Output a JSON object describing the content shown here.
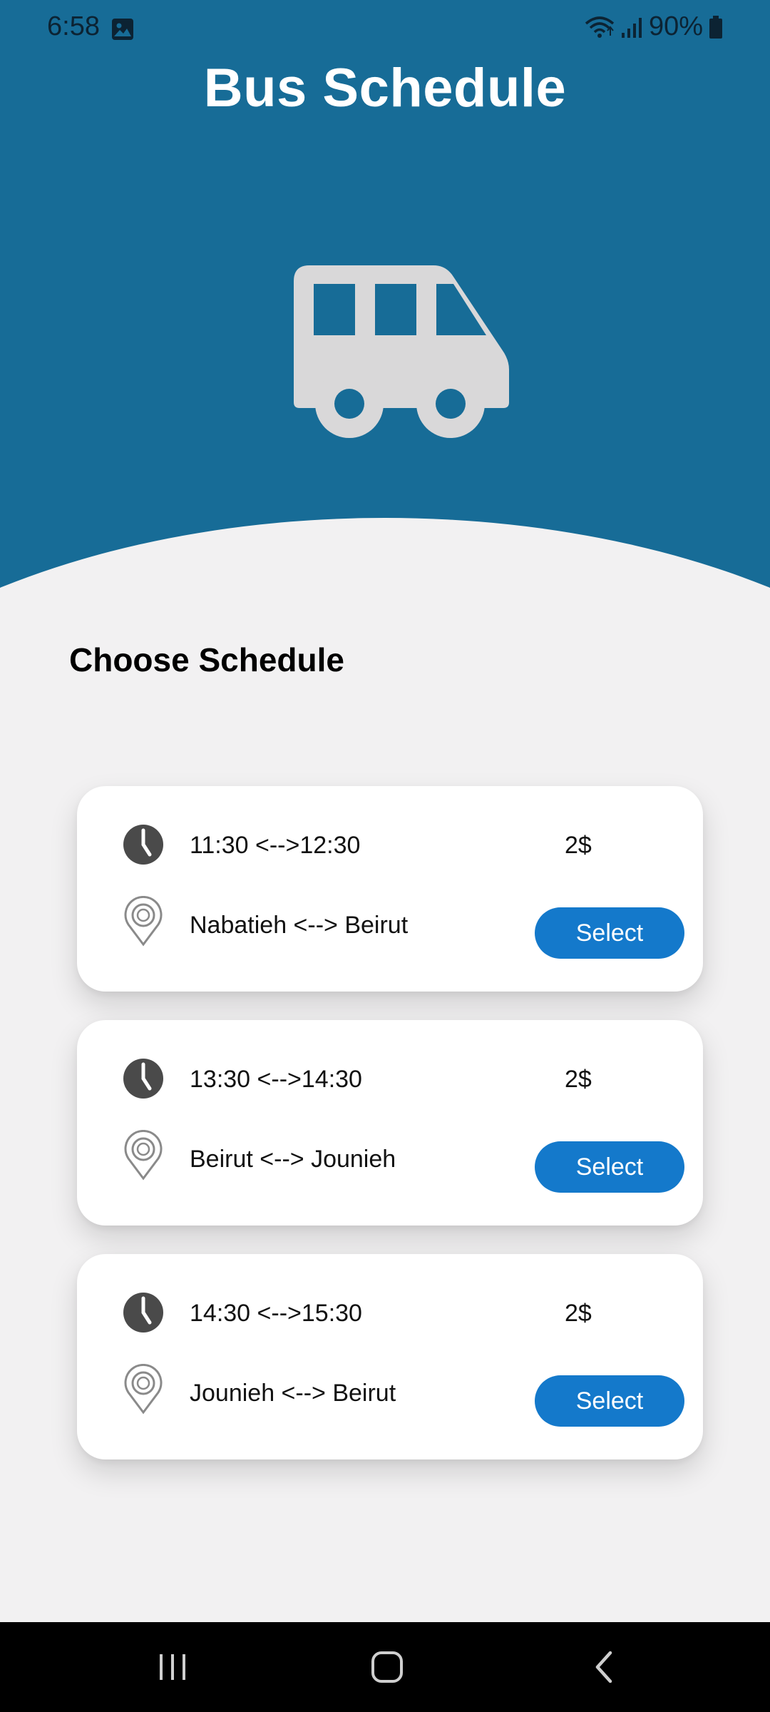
{
  "status_bar": {
    "time": "6:58",
    "battery": "90%",
    "icons": [
      "photo-icon",
      "wifi-icon",
      "signal-icon",
      "battery-icon"
    ]
  },
  "header": {
    "title": "Bus Schedule",
    "illustration": "bus-icon",
    "background_color": "#176c97"
  },
  "section": {
    "title": "Choose Schedule"
  },
  "schedules": [
    {
      "time": "11:30 <-->12:30",
      "route": "Nabatieh <--> Beirut",
      "price": "2$",
      "button": "Select"
    },
    {
      "time": "13:30 <-->14:30",
      "route": "Beirut <--> Jounieh",
      "price": "2$",
      "button": "Select"
    },
    {
      "time": "14:30 <-->15:30",
      "route": "Jounieh <--> Beirut",
      "price": "2$",
      "button": "Select"
    }
  ],
  "nav": {
    "icons": [
      "recent-apps-icon",
      "home-icon",
      "back-icon"
    ]
  },
  "colors": {
    "accent": "#1479cb",
    "background": "#f2f1f2"
  }
}
